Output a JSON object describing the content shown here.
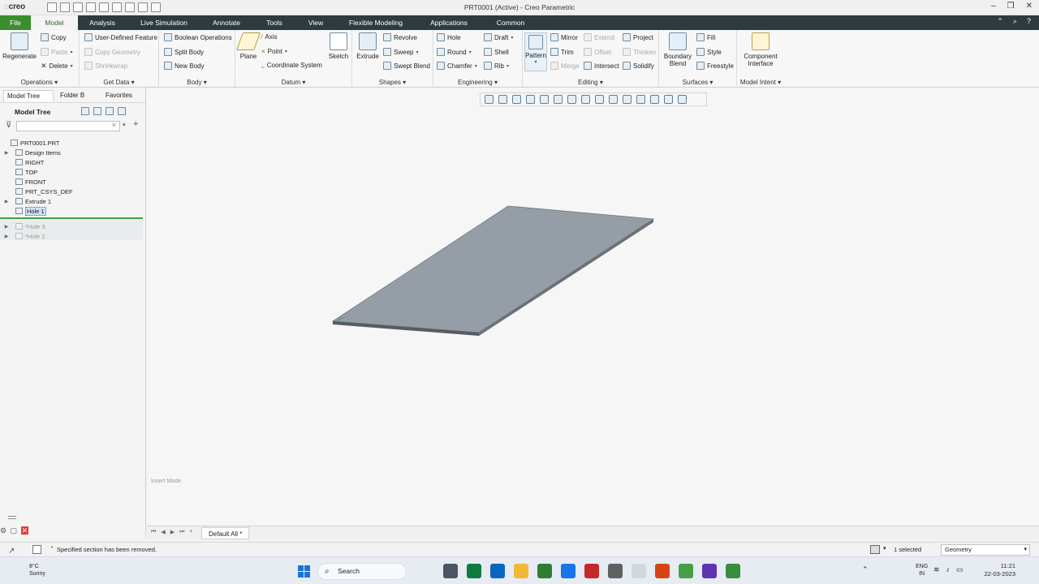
{
  "app": {
    "logo": "creo",
    "window_title": "PRT0001 (Active) - Creo Parametric"
  },
  "menu": {
    "tabs": [
      "File",
      "Model",
      "Analysis",
      "Live Simulation",
      "Annotate",
      "Tools",
      "View",
      "Flexible Modeling",
      "Applications",
      "Common"
    ],
    "active": "Model"
  },
  "ribbon": {
    "operations": {
      "label": "Operations",
      "regenerate": "Regenerate",
      "copy": "Copy",
      "paste": "Paste",
      "delete": "Delete"
    },
    "get_data": {
      "label": "Get Data",
      "user_defined_feature": "User-Defined Feature",
      "copy_geometry": "Copy Geometry",
      "shrinkwrap": "Shrinkwrap"
    },
    "body": {
      "label": "Body",
      "boolean_operations": "Boolean Operations",
      "split_body": "Split Body",
      "new_body": "New Body"
    },
    "datum": {
      "label": "Datum",
      "plane": "Plane",
      "axis": "Axis",
      "point": "Point",
      "coordinate_system": "Coordinate System",
      "sketch": "Sketch"
    },
    "shapes": {
      "label": "Shapes",
      "extrude": "Extrude",
      "revolve": "Revolve",
      "sweep": "Sweep",
      "swept_blend": "Swept Blend"
    },
    "engineering": {
      "label": "Engineering",
      "hole": "Hole",
      "round": "Round",
      "chamfer": "Chamfer",
      "draft": "Draft",
      "shell": "Shell",
      "rib": "Rib"
    },
    "editing": {
      "label": "Editing",
      "pattern": "Pattern",
      "mirror": "Mirror",
      "trim": "Trim",
      "merge": "Merge",
      "extend": "Extend",
      "offset": "Offset",
      "intersect": "Intersect",
      "project": "Project",
      "thicken": "Thicken",
      "solidify": "Solidify"
    },
    "surfaces": {
      "label": "Surfaces",
      "boundary_blend": "Boundary Blend",
      "fill": "Fill",
      "style": "Style",
      "freestyle": "Freestyle"
    },
    "model_intent": {
      "label": "Model Intent",
      "component_interface": "Component Interface"
    }
  },
  "left_panel": {
    "tabs": [
      "Model Tree",
      "Folder B",
      "Favorites"
    ],
    "title": "Model Tree",
    "filter_placeholder": "",
    "tree": [
      {
        "label": "PRT0001.PRT",
        "expandable": false,
        "indent": 0
      },
      {
        "label": "Design Items",
        "expandable": true,
        "indent": 1
      },
      {
        "label": "RIGHT",
        "expandable": false,
        "indent": 1
      },
      {
        "label": "TOP",
        "expandable": false,
        "indent": 1
      },
      {
        "label": "FRONT",
        "expandable": false,
        "indent": 1
      },
      {
        "label": "PRT_CSYS_DEF",
        "expandable": false,
        "indent": 1
      },
      {
        "label": "Extrude 1",
        "expandable": true,
        "indent": 1
      },
      {
        "label": "Hole 1",
        "expandable": false,
        "indent": 1,
        "selected": true
      }
    ],
    "suppressed": [
      {
        "label": "Hole 3"
      },
      {
        "label": "Hole 2"
      }
    ]
  },
  "viewport": {
    "mode_text": "Insert Mode",
    "plate_color": "#959ea6"
  },
  "bottom_tabs": {
    "active": "Default All *"
  },
  "status": {
    "message": "Specified section has been removed.",
    "selected": "1 selected",
    "filter": "Geometry"
  },
  "taskbar": {
    "weather_temp": "8°C",
    "weather_desc": "Sunny",
    "search": "Search",
    "lang_1": "ENG",
    "lang_2": "IN",
    "time": "11:21",
    "date": "22-03-2023"
  },
  "colors": {
    "accent": "#3b8d2f",
    "menubar": "#2e3a3f",
    "insert_marker": "#43a047"
  }
}
